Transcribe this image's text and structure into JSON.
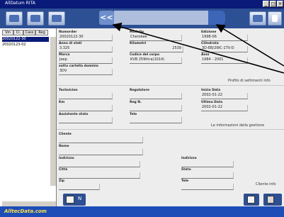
{
  "window": {
    "title": "AllDatum RITA"
  },
  "toolbar": {
    "back_label": "<<"
  },
  "sidebar": {
    "tabs": [
      "Vin",
      "Cl.",
      "Cass",
      "Reg"
    ],
    "items": [
      "20020122-30",
      "20020123-02"
    ]
  },
  "fields": {
    "ordine_label": "Numorder",
    "ordine_value": "20020122-30",
    "modello_label": "Modello",
    "modello_value": "Cherokee",
    "edizione_label": "Edizione",
    "edizione_value": "1998-06",
    "anno_label": "Anno di stati",
    "anno_value": "3.325",
    "kilometri_label": "Kilometri",
    "kilometri_value": "2539",
    "cilindrata_label": "Cilindrata",
    "cilindrata_value": "3D-EB/2WC-1TV-D",
    "marca_label": "Marca",
    "marca_value": "Jeep",
    "codice_label": "Codice del corpo",
    "codice_value": "KVB 259thra(1014)",
    "anno2_label": "Anni",
    "anno2_value": "1984 - 2001",
    "sottocartella_label": "sotto cartella dominio",
    "sottocartella_value": "3DV"
  },
  "notes": {
    "profile": "Profilo di settimenti info",
    "management": "Le informazioni della gestione",
    "client": "Cliente info"
  },
  "work": {
    "tecnico_label": "Technicien",
    "regolatore_label": "Regolatore",
    "data_inizio_label": "Inizio Data",
    "data_inizio_value": "2002-01-22",
    "km_label": "Km",
    "reg_label": "Reg N.",
    "ultima_label": "Ultima Data",
    "ultima_value": "2002-01-22",
    "assistente_label": "Assistente stato",
    "tele_label": "Tele"
  },
  "client": {
    "cliente_label": "Cliente",
    "nome_label": "Nome",
    "indirizzo_label": "Indirizzo",
    "indirizzo2_label": "Indirizzo",
    "citta_label": "Città",
    "stato_label": "Stato",
    "zip_label": "Zip",
    "tele_label": "Tele"
  },
  "bottom": {
    "new_label": "N"
  },
  "status": {
    "logo": "AlltecData.com"
  },
  "colors": {
    "toolbar": "#2d4f93",
    "titlebar": "#0a1a78",
    "statusbar": "#1e4db8"
  }
}
